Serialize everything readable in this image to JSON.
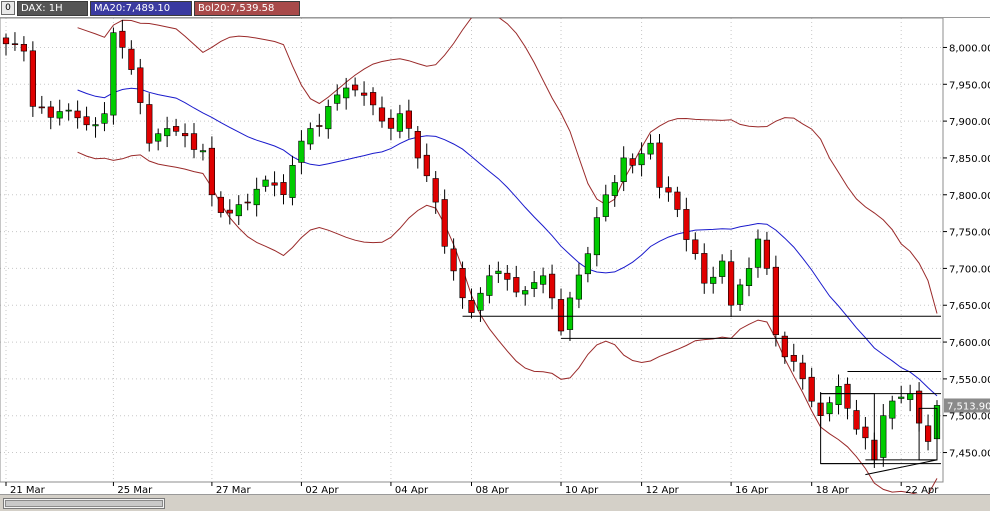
{
  "header": {
    "menu_glyph": "0",
    "symbol_label": "DAX: 1H",
    "ma_label": "MA20:7,489.10",
    "bol_label": "Bol20:7,539.58"
  },
  "colors": {
    "up": "#00cc00",
    "down": "#e00000",
    "wick": "#000000",
    "ma": "#1a1acc",
    "bollinger": "#9a2a2a",
    "grid": "#c8c8c8",
    "symbol_bg": "#555555",
    "ma_bg": "#3a3aa0",
    "bol_bg": "#a84a4a",
    "price_tag": "#8a8a8a"
  },
  "chart_data": {
    "type": "candlestick",
    "timeframe": "1H",
    "ylim": [
      7410,
      8040
    ],
    "y_ticks": [
      7450,
      7500,
      7550,
      7600,
      7650,
      7700,
      7750,
      7800,
      7850,
      7900,
      7950,
      8000
    ],
    "y_tick_labels": [
      "7,450.00",
      "7,500.00",
      "7,550.00",
      "7,600.00",
      "7,650.00",
      "7,700.00",
      "7,750.00",
      "7,800.00",
      "7,850.00",
      "7,900.00",
      "7,950.00",
      "8,000.00"
    ],
    "x_labels": [
      {
        "label": "21 Mar",
        "bar": 0
      },
      {
        "label": "25 Mar",
        "bar": 12
      },
      {
        "label": "27 Mar",
        "bar": 23
      },
      {
        "label": "02 Apr",
        "bar": 33
      },
      {
        "label": "04 Apr",
        "bar": 43
      },
      {
        "label": "08 Apr",
        "bar": 52
      },
      {
        "label": "10 Apr",
        "bar": 62
      },
      {
        "label": "12 Apr",
        "bar": 71
      },
      {
        "label": "16 Apr",
        "bar": 81
      },
      {
        "label": "18 Apr",
        "bar": 90
      },
      {
        "label": "22 Apr",
        "bar": 100
      }
    ],
    "bar_count": 105,
    "last_price": 7513.9,
    "last_price_label": "7,513.90",
    "anchors": [
      [
        0,
        8005
      ],
      [
        2,
        7995
      ],
      [
        3,
        7920
      ],
      [
        5,
        7905
      ],
      [
        7,
        7915
      ],
      [
        9,
        7895
      ],
      [
        11,
        7910
      ],
      [
        12,
        8020
      ],
      [
        13,
        8000
      ],
      [
        14,
        7970
      ],
      [
        16,
        7870
      ],
      [
        18,
        7890
      ],
      [
        20,
        7880
      ],
      [
        22,
        7860
      ],
      [
        23,
        7800
      ],
      [
        25,
        7775
      ],
      [
        27,
        7790
      ],
      [
        29,
        7820
      ],
      [
        31,
        7800
      ],
      [
        32,
        7840
      ],
      [
        34,
        7890
      ],
      [
        36,
        7920
      ],
      [
        38,
        7945
      ],
      [
        40,
        7935
      ],
      [
        42,
        7900
      ],
      [
        43,
        7890
      ],
      [
        44,
        7910
      ],
      [
        45,
        7890
      ],
      [
        46,
        7850
      ],
      [
        48,
        7790
      ],
      [
        49,
        7730
      ],
      [
        51,
        7660
      ],
      [
        52,
        7640
      ],
      [
        54,
        7690
      ],
      [
        56,
        7685
      ],
      [
        58,
        7670
      ],
      [
        60,
        7690
      ],
      [
        61,
        7660
      ],
      [
        62,
        7615
      ],
      [
        63,
        7660
      ],
      [
        65,
        7720
      ],
      [
        67,
        7800
      ],
      [
        69,
        7850
      ],
      [
        70,
        7840
      ],
      [
        72,
        7870
      ],
      [
        73,
        7810
      ],
      [
        75,
        7780
      ],
      [
        77,
        7720
      ],
      [
        78,
        7680
      ],
      [
        80,
        7710
      ],
      [
        81,
        7650
      ],
      [
        83,
        7700
      ],
      [
        84,
        7740
      ],
      [
        85,
        7700
      ],
      [
        86,
        7610
      ],
      [
        87,
        7580
      ],
      [
        89,
        7550
      ],
      [
        91,
        7500
      ],
      [
        93,
        7540
      ],
      [
        94,
        7510
      ],
      [
        96,
        7470
      ],
      [
        97,
        7440
      ],
      [
        98,
        7500
      ],
      [
        99,
        7520
      ],
      [
        101,
        7530
      ],
      [
        102,
        7490
      ],
      [
        103,
        7465
      ],
      [
        104,
        7514
      ]
    ],
    "ma_period": 20,
    "bollinger_sigma": 2,
    "horizontal_lines": [
      {
        "y": 7635,
        "x_from_bar": 51,
        "x_to_bar": 104
      },
      {
        "y": 7605,
        "x_from_bar": 62,
        "x_to_bar": 104
      },
      {
        "y": 7560,
        "x_from_bar": 94,
        "x_to_bar": 104
      },
      {
        "y": 7530,
        "x_from_bar": 91,
        "x_to_bar": 104
      },
      {
        "y": 7435,
        "x_from_bar": 91,
        "x_to_bar": 104
      }
    ],
    "boxes": [
      {
        "bar_from": 91,
        "bar_to": 97,
        "y_top": 7530,
        "y_bottom": 7435
      },
      {
        "bar_from": 102,
        "bar_to": 104,
        "y_top": 7510,
        "y_bottom": 7440
      }
    ],
    "trend_lines": [
      {
        "bar_from": 96,
        "y_from": 7420,
        "bar_to": 104,
        "y_to": 7440
      },
      {
        "bar_from": 96,
        "y_from": 7440,
        "bar_to": 104,
        "y_to": 7440
      }
    ],
    "grid": true,
    "legend": "top-left"
  }
}
